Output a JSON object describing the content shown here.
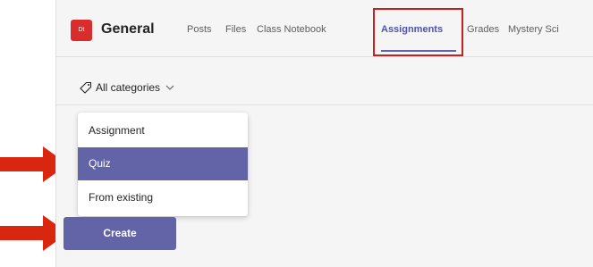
{
  "team": {
    "avatar_initials": "Dt",
    "avatar_color": "#d92c2c",
    "channel_name": "General"
  },
  "tabs": [
    {
      "label": "Posts"
    },
    {
      "label": "Files"
    },
    {
      "label": "Class Notebook"
    },
    {
      "label": "Assignments",
      "active": true
    },
    {
      "label": "Grades"
    },
    {
      "label": "Mystery Sci"
    }
  ],
  "filter": {
    "label": "All categories",
    "icon": "tag-icon"
  },
  "dropdown": {
    "items": [
      {
        "label": "Assignment"
      },
      {
        "label": "Quiz",
        "selected": true
      },
      {
        "label": "From existing"
      }
    ]
  },
  "create_button": {
    "label": "Create"
  },
  "colors": {
    "accent": "#6264a7",
    "highlight_box": "#c8201f",
    "annotation_arrow": "#d9260f"
  }
}
